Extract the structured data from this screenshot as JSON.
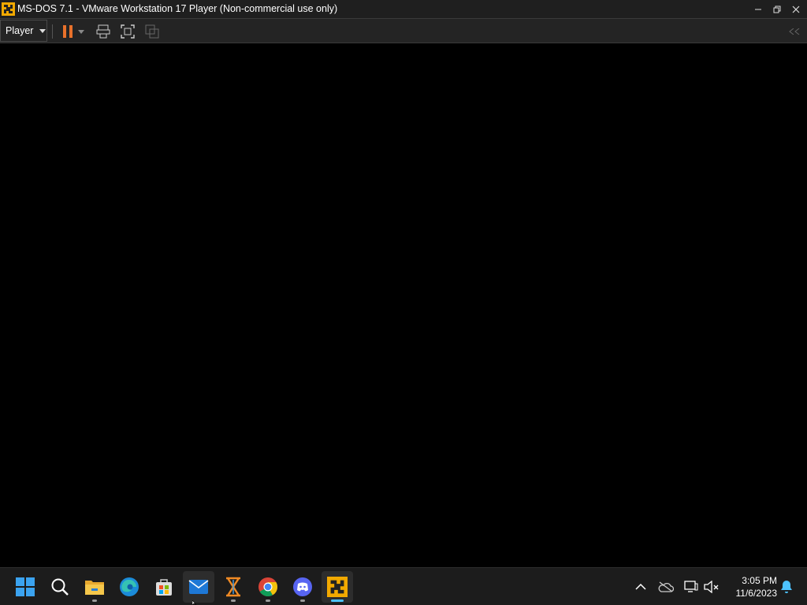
{
  "window": {
    "title": "MS-DOS 7.1 - VMware Workstation 17 Player (Non-commercial use only)",
    "controls": [
      "minimize-icon",
      "restore-icon",
      "close-icon"
    ]
  },
  "toolbar": {
    "player_menu_label": "Player",
    "icons": [
      "pause-icon",
      "dropdown-caret-icon",
      "send-ctrl-alt-del-icon",
      "fullscreen-icon",
      "unity-icon",
      "collapse-toolbar-icon"
    ],
    "pause_color": "#e8712b"
  },
  "vm_screen": {
    "background": "#000000"
  },
  "taskbar": {
    "apps": [
      {
        "name": "start",
        "icon": "windows-start-icon"
      },
      {
        "name": "search",
        "icon": "search-icon"
      },
      {
        "name": "file-explorer",
        "icon": "folder-icon",
        "running": true
      },
      {
        "name": "edge",
        "icon": "edge-icon"
      },
      {
        "name": "microsoft-store",
        "icon": "store-icon"
      },
      {
        "name": "mail",
        "icon": "mail-icon",
        "hovered": true
      },
      {
        "name": "xampp",
        "icon": "xampp-icon",
        "running": true
      },
      {
        "name": "chrome",
        "icon": "chrome-icon",
        "running": true
      },
      {
        "name": "discord",
        "icon": "discord-icon",
        "running": true
      },
      {
        "name": "vmware",
        "icon": "vmware-icon",
        "running": true,
        "active": true
      }
    ],
    "tray": {
      "icons": [
        "chevron-up-icon",
        "onedrive-offline-icon",
        "network-icon",
        "volume-muted-icon",
        "notification-bell-icon"
      ],
      "time": "3:05 PM",
      "date": "11/6/2023"
    }
  }
}
